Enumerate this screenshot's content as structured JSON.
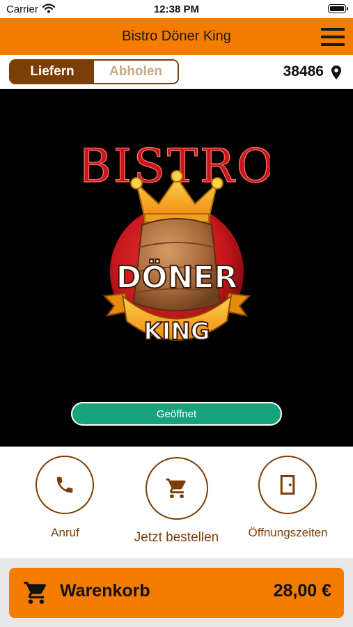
{
  "status_bar": {
    "carrier": "Carrier",
    "time": "12:38 PM"
  },
  "header": {
    "title": "Bistro Döner King"
  },
  "mode": {
    "deliver_label": "Liefern",
    "pickup_label": "Abholen",
    "selected": "Liefern",
    "postcode": "38486"
  },
  "logo": {
    "top_text": "BISTRO",
    "middle_text": "DÖNER",
    "bottom_text": "KING"
  },
  "hero": {
    "status_label": "Geöffnet"
  },
  "actions": [
    {
      "label": "Anruf",
      "icon": "phone-icon"
    },
    {
      "label": "Jetzt bestellen",
      "icon": "cart-icon"
    },
    {
      "label": "Öffnungszeiten",
      "icon": "door-icon"
    }
  ],
  "cart": {
    "label": "Warenkorb",
    "total": "28,00 €"
  },
  "colors": {
    "accent": "#f47c00",
    "brown": "#7a3e06",
    "open_green": "#17a47d",
    "hero_bg": "#000000"
  }
}
